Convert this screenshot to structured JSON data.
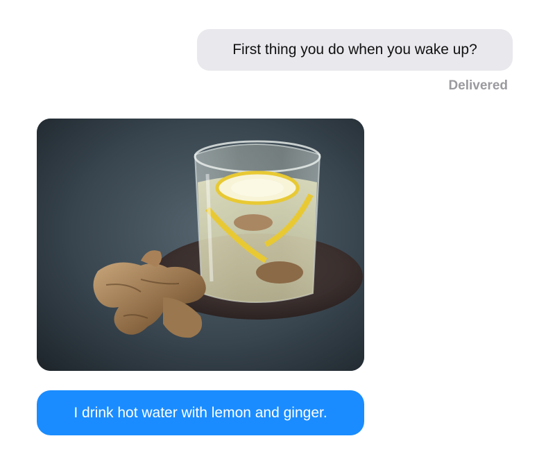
{
  "conversation": {
    "outgoing_message": "First thing you do when you wake up?",
    "status": "Delivered",
    "incoming_message": "I drink hot water with lemon and ginger."
  },
  "colors": {
    "outgoing_bubble": "#e8e8ed",
    "incoming_bubble": "#1a8cff",
    "status_text": "#9a9a9f"
  }
}
